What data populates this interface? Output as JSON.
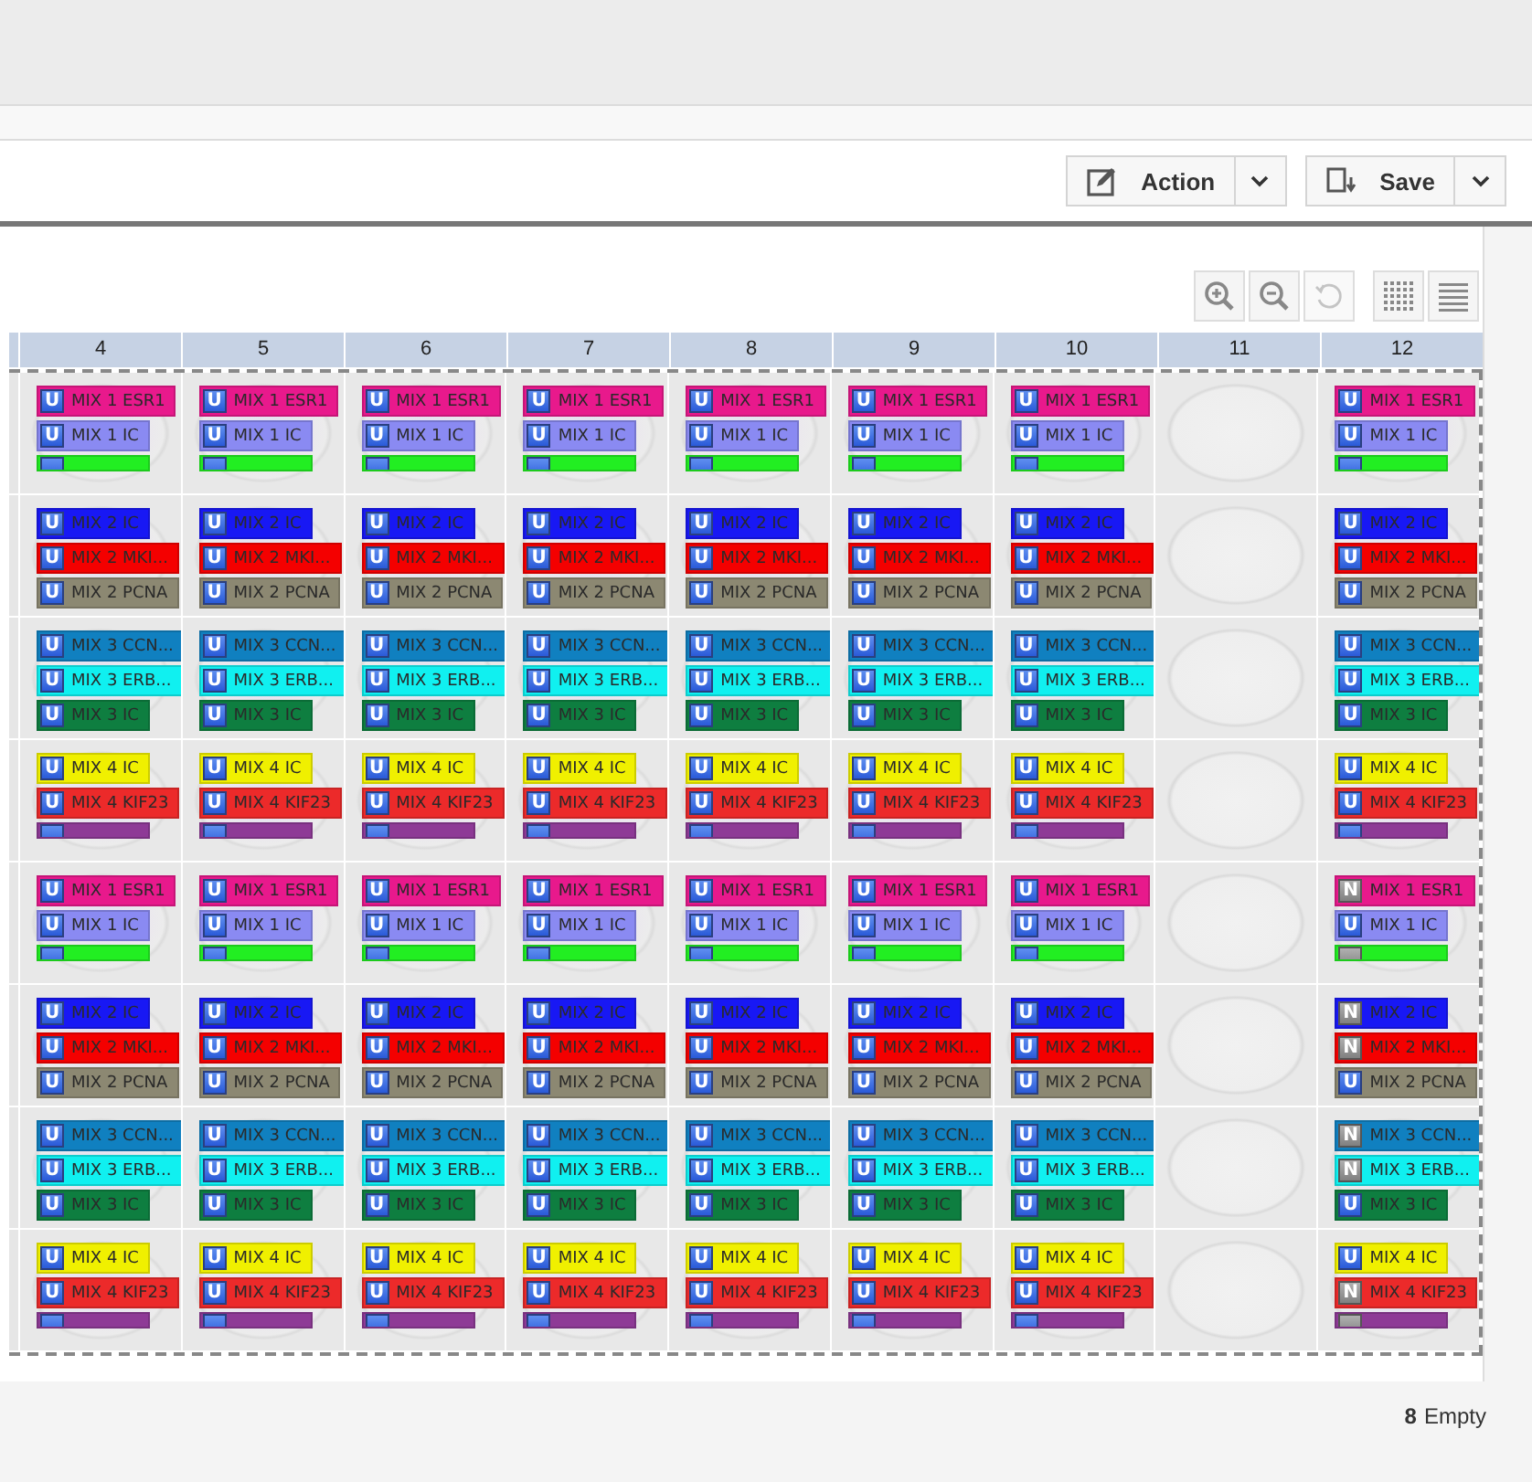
{
  "toolbar": {
    "buttons": [
      {
        "label": "Action"
      },
      {
        "label": "Save"
      }
    ]
  },
  "view_tools": [
    {
      "disabled": false
    },
    {
      "disabled": false
    },
    {
      "disabled": true
    },
    {
      "disabled": false
    },
    {
      "disabled": false
    }
  ],
  "plate": {
    "columns": [
      "4",
      "5",
      "6",
      "7",
      "8",
      "9",
      "10",
      "11",
      "12"
    ],
    "rows": [
      {
        "wells": [
          {
            "tags": [
              {
                "badge": "U",
                "kind": "u",
                "label": "MIX 1 ESR1",
                "color": "#e8198c"
              },
              {
                "badge": "U",
                "kind": "u",
                "label": "MIX 1 IC",
                "color": "#8a8af2"
              },
              {
                "kind": "u",
                "color": "#22ee22"
              }
            ]
          },
          {
            "tags": [
              {
                "badge": "U",
                "kind": "u",
                "label": "MIX 1 ESR1",
                "color": "#e8198c"
              },
              {
                "badge": "U",
                "kind": "u",
                "label": "MIX 1 IC",
                "color": "#8a8af2"
              },
              {
                "kind": "u",
                "color": "#22ee22"
              }
            ]
          },
          {
            "tags": [
              {
                "badge": "U",
                "kind": "u",
                "label": "MIX 1 ESR1",
                "color": "#e8198c"
              },
              {
                "badge": "U",
                "kind": "u",
                "label": "MIX 1 IC",
                "color": "#8a8af2"
              },
              {
                "kind": "u",
                "color": "#22ee22"
              }
            ]
          },
          {
            "tags": [
              {
                "badge": "U",
                "kind": "u",
                "label": "MIX 1 ESR1",
                "color": "#e8198c"
              },
              {
                "badge": "U",
                "kind": "u",
                "label": "MIX 1 IC",
                "color": "#8a8af2"
              },
              {
                "kind": "u",
                "color": "#22ee22"
              }
            ]
          },
          {
            "tags": [
              {
                "badge": "U",
                "kind": "u",
                "label": "MIX 1 ESR1",
                "color": "#e8198c"
              },
              {
                "badge": "U",
                "kind": "u",
                "label": "MIX 1 IC",
                "color": "#8a8af2"
              },
              {
                "kind": "u",
                "color": "#22ee22"
              }
            ]
          },
          {
            "tags": [
              {
                "badge": "U",
                "kind": "u",
                "label": "MIX 1 ESR1",
                "color": "#e8198c"
              },
              {
                "badge": "U",
                "kind": "u",
                "label": "MIX 1 IC",
                "color": "#8a8af2"
              },
              {
                "kind": "u",
                "color": "#22ee22"
              }
            ]
          },
          {
            "tags": [
              {
                "badge": "U",
                "kind": "u",
                "label": "MIX 1 ESR1",
                "color": "#e8198c"
              },
              {
                "badge": "U",
                "kind": "u",
                "label": "MIX 1 IC",
                "color": "#8a8af2"
              },
              {
                "kind": "u",
                "color": "#22ee22"
              }
            ]
          },
          {
            "kind": "empty"
          },
          {
            "tags": [
              {
                "badge": "U",
                "kind": "u",
                "label": "MIX 1 ESR1",
                "color": "#e8198c"
              },
              {
                "badge": "U",
                "kind": "u",
                "label": "MIX 1 IC",
                "color": "#8a8af2"
              },
              {
                "kind": "u",
                "color": "#22ee22"
              }
            ]
          }
        ]
      },
      {
        "wells": [
          {
            "tags": [
              {
                "badge": "U",
                "kind": "u",
                "label": "MIX 2 IC",
                "color": "#1818f4"
              },
              {
                "badge": "U",
                "kind": "u",
                "label": "MIX 2 MKI...",
                "color": "#f40000"
              },
              {
                "badge": "U",
                "kind": "u",
                "label": "MIX 2 PCNA",
                "color": "#8c8872"
              }
            ]
          },
          {
            "tags": [
              {
                "badge": "U",
                "kind": "u",
                "label": "MIX 2 IC",
                "color": "#1818f4"
              },
              {
                "badge": "U",
                "kind": "u",
                "label": "MIX 2 MKI...",
                "color": "#f40000"
              },
              {
                "badge": "U",
                "kind": "u",
                "label": "MIX 2 PCNA",
                "color": "#8c8872"
              }
            ]
          },
          {
            "tags": [
              {
                "badge": "U",
                "kind": "u",
                "label": "MIX 2 IC",
                "color": "#1818f4"
              },
              {
                "badge": "U",
                "kind": "u",
                "label": "MIX 2 MKI...",
                "color": "#f40000"
              },
              {
                "badge": "U",
                "kind": "u",
                "label": "MIX 2 PCNA",
                "color": "#8c8872"
              }
            ]
          },
          {
            "tags": [
              {
                "badge": "U",
                "kind": "u",
                "label": "MIX 2 IC",
                "color": "#1818f4"
              },
              {
                "badge": "U",
                "kind": "u",
                "label": "MIX 2 MKI...",
                "color": "#f40000"
              },
              {
                "badge": "U",
                "kind": "u",
                "label": "MIX 2 PCNA",
                "color": "#8c8872"
              }
            ]
          },
          {
            "tags": [
              {
                "badge": "U",
                "kind": "u",
                "label": "MIX 2 IC",
                "color": "#1818f4"
              },
              {
                "badge": "U",
                "kind": "u",
                "label": "MIX 2 MKI...",
                "color": "#f40000"
              },
              {
                "badge": "U",
                "kind": "u",
                "label": "MIX 2 PCNA",
                "color": "#8c8872"
              }
            ]
          },
          {
            "tags": [
              {
                "badge": "U",
                "kind": "u",
                "label": "MIX 2 IC",
                "color": "#1818f4"
              },
              {
                "badge": "U",
                "kind": "u",
                "label": "MIX 2 MKI...",
                "color": "#f40000"
              },
              {
                "badge": "U",
                "kind": "u",
                "label": "MIX 2 PCNA",
                "color": "#8c8872"
              }
            ]
          },
          {
            "tags": [
              {
                "badge": "U",
                "kind": "u",
                "label": "MIX 2 IC",
                "color": "#1818f4"
              },
              {
                "badge": "U",
                "kind": "u",
                "label": "MIX 2 MKI...",
                "color": "#f40000"
              },
              {
                "badge": "U",
                "kind": "u",
                "label": "MIX 2 PCNA",
                "color": "#8c8872"
              }
            ]
          },
          {
            "kind": "empty"
          },
          {
            "tags": [
              {
                "badge": "U",
                "kind": "u",
                "label": "MIX 2 IC",
                "color": "#1818f4"
              },
              {
                "badge": "U",
                "kind": "u",
                "label": "MIX 2 MKI...",
                "color": "#f40000"
              },
              {
                "badge": "U",
                "kind": "u",
                "label": "MIX 2 PCNA",
                "color": "#8c8872"
              }
            ]
          }
        ]
      },
      {
        "wells": [
          {
            "tags": [
              {
                "badge": "U",
                "kind": "u",
                "label": "MIX 3 CCN...",
                "color": "#1080c0"
              },
              {
                "badge": "U",
                "kind": "u",
                "label": "MIX 3 ERB...",
                "color": "#10f0f0"
              },
              {
                "badge": "U",
                "kind": "u",
                "label": "MIX 3 IC",
                "color": "#0e7e40"
              }
            ]
          },
          {
            "tags": [
              {
                "badge": "U",
                "kind": "u",
                "label": "MIX 3 CCN...",
                "color": "#1080c0"
              },
              {
                "badge": "U",
                "kind": "u",
                "label": "MIX 3 ERB...",
                "color": "#10f0f0"
              },
              {
                "badge": "U",
                "kind": "u",
                "label": "MIX 3 IC",
                "color": "#0e7e40"
              }
            ]
          },
          {
            "tags": [
              {
                "badge": "U",
                "kind": "u",
                "label": "MIX 3 CCN...",
                "color": "#1080c0"
              },
              {
                "badge": "U",
                "kind": "u",
                "label": "MIX 3 ERB...",
                "color": "#10f0f0"
              },
              {
                "badge": "U",
                "kind": "u",
                "label": "MIX 3 IC",
                "color": "#0e7e40"
              }
            ]
          },
          {
            "tags": [
              {
                "badge": "U",
                "kind": "u",
                "label": "MIX 3 CCN...",
                "color": "#1080c0"
              },
              {
                "badge": "U",
                "kind": "u",
                "label": "MIX 3 ERB...",
                "color": "#10f0f0"
              },
              {
                "badge": "U",
                "kind": "u",
                "label": "MIX 3 IC",
                "color": "#0e7e40"
              }
            ]
          },
          {
            "tags": [
              {
                "badge": "U",
                "kind": "u",
                "label": "MIX 3 CCN...",
                "color": "#1080c0"
              },
              {
                "badge": "U",
                "kind": "u",
                "label": "MIX 3 ERB...",
                "color": "#10f0f0"
              },
              {
                "badge": "U",
                "kind": "u",
                "label": "MIX 3 IC",
                "color": "#0e7e40"
              }
            ]
          },
          {
            "tags": [
              {
                "badge": "U",
                "kind": "u",
                "label": "MIX 3 CCN...",
                "color": "#1080c0"
              },
              {
                "badge": "U",
                "kind": "u",
                "label": "MIX 3 ERB...",
                "color": "#10f0f0"
              },
              {
                "badge": "U",
                "kind": "u",
                "label": "MIX 3 IC",
                "color": "#0e7e40"
              }
            ]
          },
          {
            "tags": [
              {
                "badge": "U",
                "kind": "u",
                "label": "MIX 3 CCN...",
                "color": "#1080c0"
              },
              {
                "badge": "U",
                "kind": "u",
                "label": "MIX 3 ERB...",
                "color": "#10f0f0"
              },
              {
                "badge": "U",
                "kind": "u",
                "label": "MIX 3 IC",
                "color": "#0e7e40"
              }
            ]
          },
          {
            "kind": "empty"
          },
          {
            "tags": [
              {
                "badge": "U",
                "kind": "u",
                "label": "MIX 3 CCN...",
                "color": "#1080c0"
              },
              {
                "badge": "U",
                "kind": "u",
                "label": "MIX 3 ERB...",
                "color": "#10f0f0"
              },
              {
                "badge": "U",
                "kind": "u",
                "label": "MIX 3 IC",
                "color": "#0e7e40"
              }
            ]
          }
        ]
      },
      {
        "wells": [
          {
            "tags": [
              {
                "badge": "U",
                "kind": "u",
                "label": "MIX 4 IC",
                "color": "#f0f000"
              },
              {
                "badge": "U",
                "kind": "u",
                "label": "MIX 4 KIF23",
                "color": "#ec2a2a"
              },
              {
                "kind": "u",
                "color": "#8e3a96"
              }
            ]
          },
          {
            "tags": [
              {
                "badge": "U",
                "kind": "u",
                "label": "MIX 4 IC",
                "color": "#f0f000"
              },
              {
                "badge": "U",
                "kind": "u",
                "label": "MIX 4 KIF23",
                "color": "#ec2a2a"
              },
              {
                "kind": "u",
                "color": "#8e3a96"
              }
            ]
          },
          {
            "tags": [
              {
                "badge": "U",
                "kind": "u",
                "label": "MIX 4 IC",
                "color": "#f0f000"
              },
              {
                "badge": "U",
                "kind": "u",
                "label": "MIX 4 KIF23",
                "color": "#ec2a2a"
              },
              {
                "kind": "u",
                "color": "#8e3a96"
              }
            ]
          },
          {
            "tags": [
              {
                "badge": "U",
                "kind": "u",
                "label": "MIX 4 IC",
                "color": "#f0f000"
              },
              {
                "badge": "U",
                "kind": "u",
                "label": "MIX 4 KIF23",
                "color": "#ec2a2a"
              },
              {
                "kind": "u",
                "color": "#8e3a96"
              }
            ]
          },
          {
            "tags": [
              {
                "badge": "U",
                "kind": "u",
                "label": "MIX 4 IC",
                "color": "#f0f000"
              },
              {
                "badge": "U",
                "kind": "u",
                "label": "MIX 4 KIF23",
                "color": "#ec2a2a"
              },
              {
                "kind": "u",
                "color": "#8e3a96"
              }
            ]
          },
          {
            "tags": [
              {
                "badge": "U",
                "kind": "u",
                "label": "MIX 4 IC",
                "color": "#f0f000"
              },
              {
                "badge": "U",
                "kind": "u",
                "label": "MIX 4 KIF23",
                "color": "#ec2a2a"
              },
              {
                "kind": "u",
                "color": "#8e3a96"
              }
            ]
          },
          {
            "tags": [
              {
                "badge": "U",
                "kind": "u",
                "label": "MIX 4 IC",
                "color": "#f0f000"
              },
              {
                "badge": "U",
                "kind": "u",
                "label": "MIX 4 KIF23",
                "color": "#ec2a2a"
              },
              {
                "kind": "u",
                "color": "#8e3a96"
              }
            ]
          },
          {
            "kind": "empty"
          },
          {
            "tags": [
              {
                "badge": "U",
                "kind": "u",
                "label": "MIX 4 IC",
                "color": "#f0f000"
              },
              {
                "badge": "U",
                "kind": "u",
                "label": "MIX 4 KIF23",
                "color": "#ec2a2a"
              },
              {
                "kind": "u",
                "color": "#8e3a96"
              }
            ]
          }
        ]
      },
      {
        "wells": [
          {
            "tags": [
              {
                "badge": "U",
                "kind": "u",
                "label": "MIX 1 ESR1",
                "color": "#e8198c"
              },
              {
                "badge": "U",
                "kind": "u",
                "label": "MIX 1 IC",
                "color": "#8a8af2"
              },
              {
                "kind": "u",
                "color": "#22ee22"
              }
            ]
          },
          {
            "tags": [
              {
                "badge": "U",
                "kind": "u",
                "label": "MIX 1 ESR1",
                "color": "#e8198c"
              },
              {
                "badge": "U",
                "kind": "u",
                "label": "MIX 1 IC",
                "color": "#8a8af2"
              },
              {
                "kind": "u",
                "color": "#22ee22"
              }
            ]
          },
          {
            "tags": [
              {
                "badge": "U",
                "kind": "u",
                "label": "MIX 1 ESR1",
                "color": "#e8198c"
              },
              {
                "badge": "U",
                "kind": "u",
                "label": "MIX 1 IC",
                "color": "#8a8af2"
              },
              {
                "kind": "u",
                "color": "#22ee22"
              }
            ]
          },
          {
            "tags": [
              {
                "badge": "U",
                "kind": "u",
                "label": "MIX 1 ESR1",
                "color": "#e8198c"
              },
              {
                "badge": "U",
                "kind": "u",
                "label": "MIX 1 IC",
                "color": "#8a8af2"
              },
              {
                "kind": "u",
                "color": "#22ee22"
              }
            ]
          },
          {
            "tags": [
              {
                "badge": "U",
                "kind": "u",
                "label": "MIX 1 ESR1",
                "color": "#e8198c"
              },
              {
                "badge": "U",
                "kind": "u",
                "label": "MIX 1 IC",
                "color": "#8a8af2"
              },
              {
                "kind": "u",
                "color": "#22ee22"
              }
            ]
          },
          {
            "tags": [
              {
                "badge": "U",
                "kind": "u",
                "label": "MIX 1 ESR1",
                "color": "#e8198c"
              },
              {
                "badge": "U",
                "kind": "u",
                "label": "MIX 1 IC",
                "color": "#8a8af2"
              },
              {
                "kind": "u",
                "color": "#22ee22"
              }
            ]
          },
          {
            "tags": [
              {
                "badge": "U",
                "kind": "u",
                "label": "MIX 1 ESR1",
                "color": "#e8198c"
              },
              {
                "badge": "U",
                "kind": "u",
                "label": "MIX 1 IC",
                "color": "#8a8af2"
              },
              {
                "kind": "u",
                "color": "#22ee22"
              }
            ]
          },
          {
            "kind": "empty"
          },
          {
            "tags": [
              {
                "badge": "N",
                "kind": "n",
                "label": "MIX 1 ESR1",
                "color": "#e8198c"
              },
              {
                "badge": "U",
                "kind": "u",
                "label": "MIX 1 IC",
                "color": "#8a8af2"
              },
              {
                "kind": "n",
                "color": "#22ee22"
              }
            ]
          }
        ]
      },
      {
        "wells": [
          {
            "tags": [
              {
                "badge": "U",
                "kind": "u",
                "label": "MIX 2 IC",
                "color": "#1818f4"
              },
              {
                "badge": "U",
                "kind": "u",
                "label": "MIX 2 MKI...",
                "color": "#f40000"
              },
              {
                "badge": "U",
                "kind": "u",
                "label": "MIX 2 PCNA",
                "color": "#8c8872"
              }
            ]
          },
          {
            "tags": [
              {
                "badge": "U",
                "kind": "u",
                "label": "MIX 2 IC",
                "color": "#1818f4"
              },
              {
                "badge": "U",
                "kind": "u",
                "label": "MIX 2 MKI...",
                "color": "#f40000"
              },
              {
                "badge": "U",
                "kind": "u",
                "label": "MIX 2 PCNA",
                "color": "#8c8872"
              }
            ]
          },
          {
            "tags": [
              {
                "badge": "U",
                "kind": "u",
                "label": "MIX 2 IC",
                "color": "#1818f4"
              },
              {
                "badge": "U",
                "kind": "u",
                "label": "MIX 2 MKI...",
                "color": "#f40000"
              },
              {
                "badge": "U",
                "kind": "u",
                "label": "MIX 2 PCNA",
                "color": "#8c8872"
              }
            ]
          },
          {
            "tags": [
              {
                "badge": "U",
                "kind": "u",
                "label": "MIX 2 IC",
                "color": "#1818f4"
              },
              {
                "badge": "U",
                "kind": "u",
                "label": "MIX 2 MKI...",
                "color": "#f40000"
              },
              {
                "badge": "U",
                "kind": "u",
                "label": "MIX 2 PCNA",
                "color": "#8c8872"
              }
            ]
          },
          {
            "tags": [
              {
                "badge": "U",
                "kind": "u",
                "label": "MIX 2 IC",
                "color": "#1818f4"
              },
              {
                "badge": "U",
                "kind": "u",
                "label": "MIX 2 MKI...",
                "color": "#f40000"
              },
              {
                "badge": "U",
                "kind": "u",
                "label": "MIX 2 PCNA",
                "color": "#8c8872"
              }
            ]
          },
          {
            "tags": [
              {
                "badge": "U",
                "kind": "u",
                "label": "MIX 2 IC",
                "color": "#1818f4"
              },
              {
                "badge": "U",
                "kind": "u",
                "label": "MIX 2 MKI...",
                "color": "#f40000"
              },
              {
                "badge": "U",
                "kind": "u",
                "label": "MIX 2 PCNA",
                "color": "#8c8872"
              }
            ]
          },
          {
            "tags": [
              {
                "badge": "U",
                "kind": "u",
                "label": "MIX 2 IC",
                "color": "#1818f4"
              },
              {
                "badge": "U",
                "kind": "u",
                "label": "MIX 2 MKI...",
                "color": "#f40000"
              },
              {
                "badge": "U",
                "kind": "u",
                "label": "MIX 2 PCNA",
                "color": "#8c8872"
              }
            ]
          },
          {
            "kind": "empty"
          },
          {
            "tags": [
              {
                "badge": "N",
                "kind": "n",
                "label": "MIX 2 IC",
                "color": "#1818f4"
              },
              {
                "badge": "N",
                "kind": "n",
                "label": "MIX 2 MKI...",
                "color": "#f40000"
              },
              {
                "badge": "U",
                "kind": "u",
                "label": "MIX 2 PCNA",
                "color": "#8c8872"
              }
            ]
          }
        ]
      },
      {
        "wells": [
          {
            "tags": [
              {
                "badge": "U",
                "kind": "u",
                "label": "MIX 3 CCN...",
                "color": "#1080c0"
              },
              {
                "badge": "U",
                "kind": "u",
                "label": "MIX 3 ERB...",
                "color": "#10f0f0"
              },
              {
                "badge": "U",
                "kind": "u",
                "label": "MIX 3 IC",
                "color": "#0e7e40"
              }
            ]
          },
          {
            "tags": [
              {
                "badge": "U",
                "kind": "u",
                "label": "MIX 3 CCN...",
                "color": "#1080c0"
              },
              {
                "badge": "U",
                "kind": "u",
                "label": "MIX 3 ERB...",
                "color": "#10f0f0"
              },
              {
                "badge": "U",
                "kind": "u",
                "label": "MIX 3 IC",
                "color": "#0e7e40"
              }
            ]
          },
          {
            "tags": [
              {
                "badge": "U",
                "kind": "u",
                "label": "MIX 3 CCN...",
                "color": "#1080c0"
              },
              {
                "badge": "U",
                "kind": "u",
                "label": "MIX 3 ERB...",
                "color": "#10f0f0"
              },
              {
                "badge": "U",
                "kind": "u",
                "label": "MIX 3 IC",
                "color": "#0e7e40"
              }
            ]
          },
          {
            "tags": [
              {
                "badge": "U",
                "kind": "u",
                "label": "MIX 3 CCN...",
                "color": "#1080c0"
              },
              {
                "badge": "U",
                "kind": "u",
                "label": "MIX 3 ERB...",
                "color": "#10f0f0"
              },
              {
                "badge": "U",
                "kind": "u",
                "label": "MIX 3 IC",
                "color": "#0e7e40"
              }
            ]
          },
          {
            "tags": [
              {
                "badge": "U",
                "kind": "u",
                "label": "MIX 3 CCN...",
                "color": "#1080c0"
              },
              {
                "badge": "U",
                "kind": "u",
                "label": "MIX 3 ERB...",
                "color": "#10f0f0"
              },
              {
                "badge": "U",
                "kind": "u",
                "label": "MIX 3 IC",
                "color": "#0e7e40"
              }
            ]
          },
          {
            "tags": [
              {
                "badge": "U",
                "kind": "u",
                "label": "MIX 3 CCN...",
                "color": "#1080c0"
              },
              {
                "badge": "U",
                "kind": "u",
                "label": "MIX 3 ERB...",
                "color": "#10f0f0"
              },
              {
                "badge": "U",
                "kind": "u",
                "label": "MIX 3 IC",
                "color": "#0e7e40"
              }
            ]
          },
          {
            "tags": [
              {
                "badge": "U",
                "kind": "u",
                "label": "MIX 3 CCN...",
                "color": "#1080c0"
              },
              {
                "badge": "U",
                "kind": "u",
                "label": "MIX 3 ERB...",
                "color": "#10f0f0"
              },
              {
                "badge": "U",
                "kind": "u",
                "label": "MIX 3 IC",
                "color": "#0e7e40"
              }
            ]
          },
          {
            "kind": "empty"
          },
          {
            "tags": [
              {
                "badge": "N",
                "kind": "n",
                "label": "MIX 3 CCN...",
                "color": "#1080c0"
              },
              {
                "badge": "N",
                "kind": "n",
                "label": "MIX 3 ERB...",
                "color": "#10f0f0"
              },
              {
                "badge": "U",
                "kind": "u",
                "label": "MIX 3 IC",
                "color": "#0e7e40"
              }
            ]
          }
        ]
      },
      {
        "wells": [
          {
            "tags": [
              {
                "badge": "U",
                "kind": "u",
                "label": "MIX 4 IC",
                "color": "#f0f000"
              },
              {
                "badge": "U",
                "kind": "u",
                "label": "MIX 4 KIF23",
                "color": "#ec2a2a"
              },
              {
                "kind": "u",
                "color": "#8e3a96"
              }
            ]
          },
          {
            "tags": [
              {
                "badge": "U",
                "kind": "u",
                "label": "MIX 4 IC",
                "color": "#f0f000"
              },
              {
                "badge": "U",
                "kind": "u",
                "label": "MIX 4 KIF23",
                "color": "#ec2a2a"
              },
              {
                "kind": "u",
                "color": "#8e3a96"
              }
            ]
          },
          {
            "tags": [
              {
                "badge": "U",
                "kind": "u",
                "label": "MIX 4 IC",
                "color": "#f0f000"
              },
              {
                "badge": "U",
                "kind": "u",
                "label": "MIX 4 KIF23",
                "color": "#ec2a2a"
              },
              {
                "kind": "u",
                "color": "#8e3a96"
              }
            ]
          },
          {
            "tags": [
              {
                "badge": "U",
                "kind": "u",
                "label": "MIX 4 IC",
                "color": "#f0f000"
              },
              {
                "badge": "U",
                "kind": "u",
                "label": "MIX 4 KIF23",
                "color": "#ec2a2a"
              },
              {
                "kind": "u",
                "color": "#8e3a96"
              }
            ]
          },
          {
            "tags": [
              {
                "badge": "U",
                "kind": "u",
                "label": "MIX 4 IC",
                "color": "#f0f000"
              },
              {
                "badge": "U",
                "kind": "u",
                "label": "MIX 4 KIF23",
                "color": "#ec2a2a"
              },
              {
                "kind": "u",
                "color": "#8e3a96"
              }
            ]
          },
          {
            "tags": [
              {
                "badge": "U",
                "kind": "u",
                "label": "MIX 4 IC",
                "color": "#f0f000"
              },
              {
                "badge": "U",
                "kind": "u",
                "label": "MIX 4 KIF23",
                "color": "#ec2a2a"
              },
              {
                "kind": "u",
                "color": "#8e3a96"
              }
            ]
          },
          {
            "tags": [
              {
                "badge": "U",
                "kind": "u",
                "label": "MIX 4 IC",
                "color": "#f0f000"
              },
              {
                "badge": "U",
                "kind": "u",
                "label": "MIX 4 KIF23",
                "color": "#ec2a2a"
              },
              {
                "kind": "u",
                "color": "#8e3a96"
              }
            ]
          },
          {
            "kind": "empty"
          },
          {
            "tags": [
              {
                "badge": "U",
                "kind": "u",
                "label": "MIX 4 IC",
                "color": "#f0f000"
              },
              {
                "badge": "N",
                "kind": "n",
                "label": "MIX 4 KIF23",
                "color": "#ec2a2a"
              },
              {
                "kind": "n",
                "color": "#8e3a96"
              }
            ]
          }
        ]
      }
    ]
  },
  "status": {
    "count": "8",
    "label": "Empty"
  }
}
